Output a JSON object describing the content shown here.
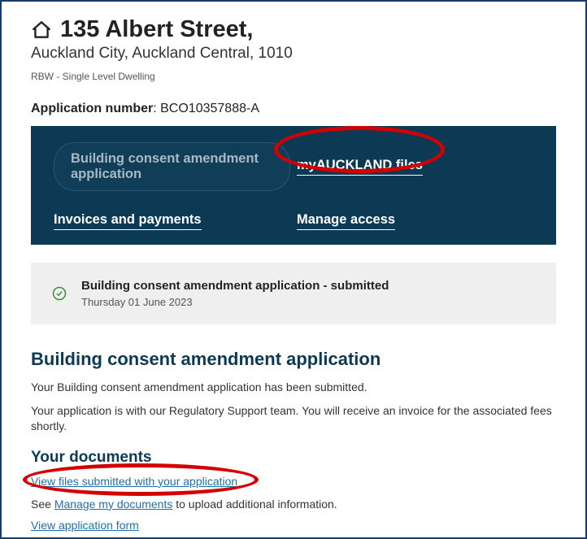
{
  "header": {
    "street": "135 Albert Street,",
    "locality": "Auckland City, Auckland Central, 1010",
    "subtype": "RBW - Single Level Dwelling"
  },
  "application": {
    "label": "Application number",
    "value": "BCO10357888-A"
  },
  "nav": {
    "item1": "Building consent amendment application",
    "item2": "myAUCKLAND files",
    "item3": "Invoices and payments",
    "item4": "Manage access"
  },
  "status": {
    "title": "Building consent amendment application - submitted",
    "date": "Thursday 01 June 2023"
  },
  "section": {
    "heading": "Building consent amendment application",
    "p1": "Your Building consent amendment application has been submitted.",
    "p2": "Your application is with our Regulatory Support team. You will receive an invoice for the associated fees shortly."
  },
  "docs": {
    "heading": "Your documents",
    "link1": "View files submitted with your application",
    "see_prefix": "See ",
    "manage_link": "Manage my documents",
    "see_suffix": " to upload additional information.",
    "link3": "View application form"
  }
}
